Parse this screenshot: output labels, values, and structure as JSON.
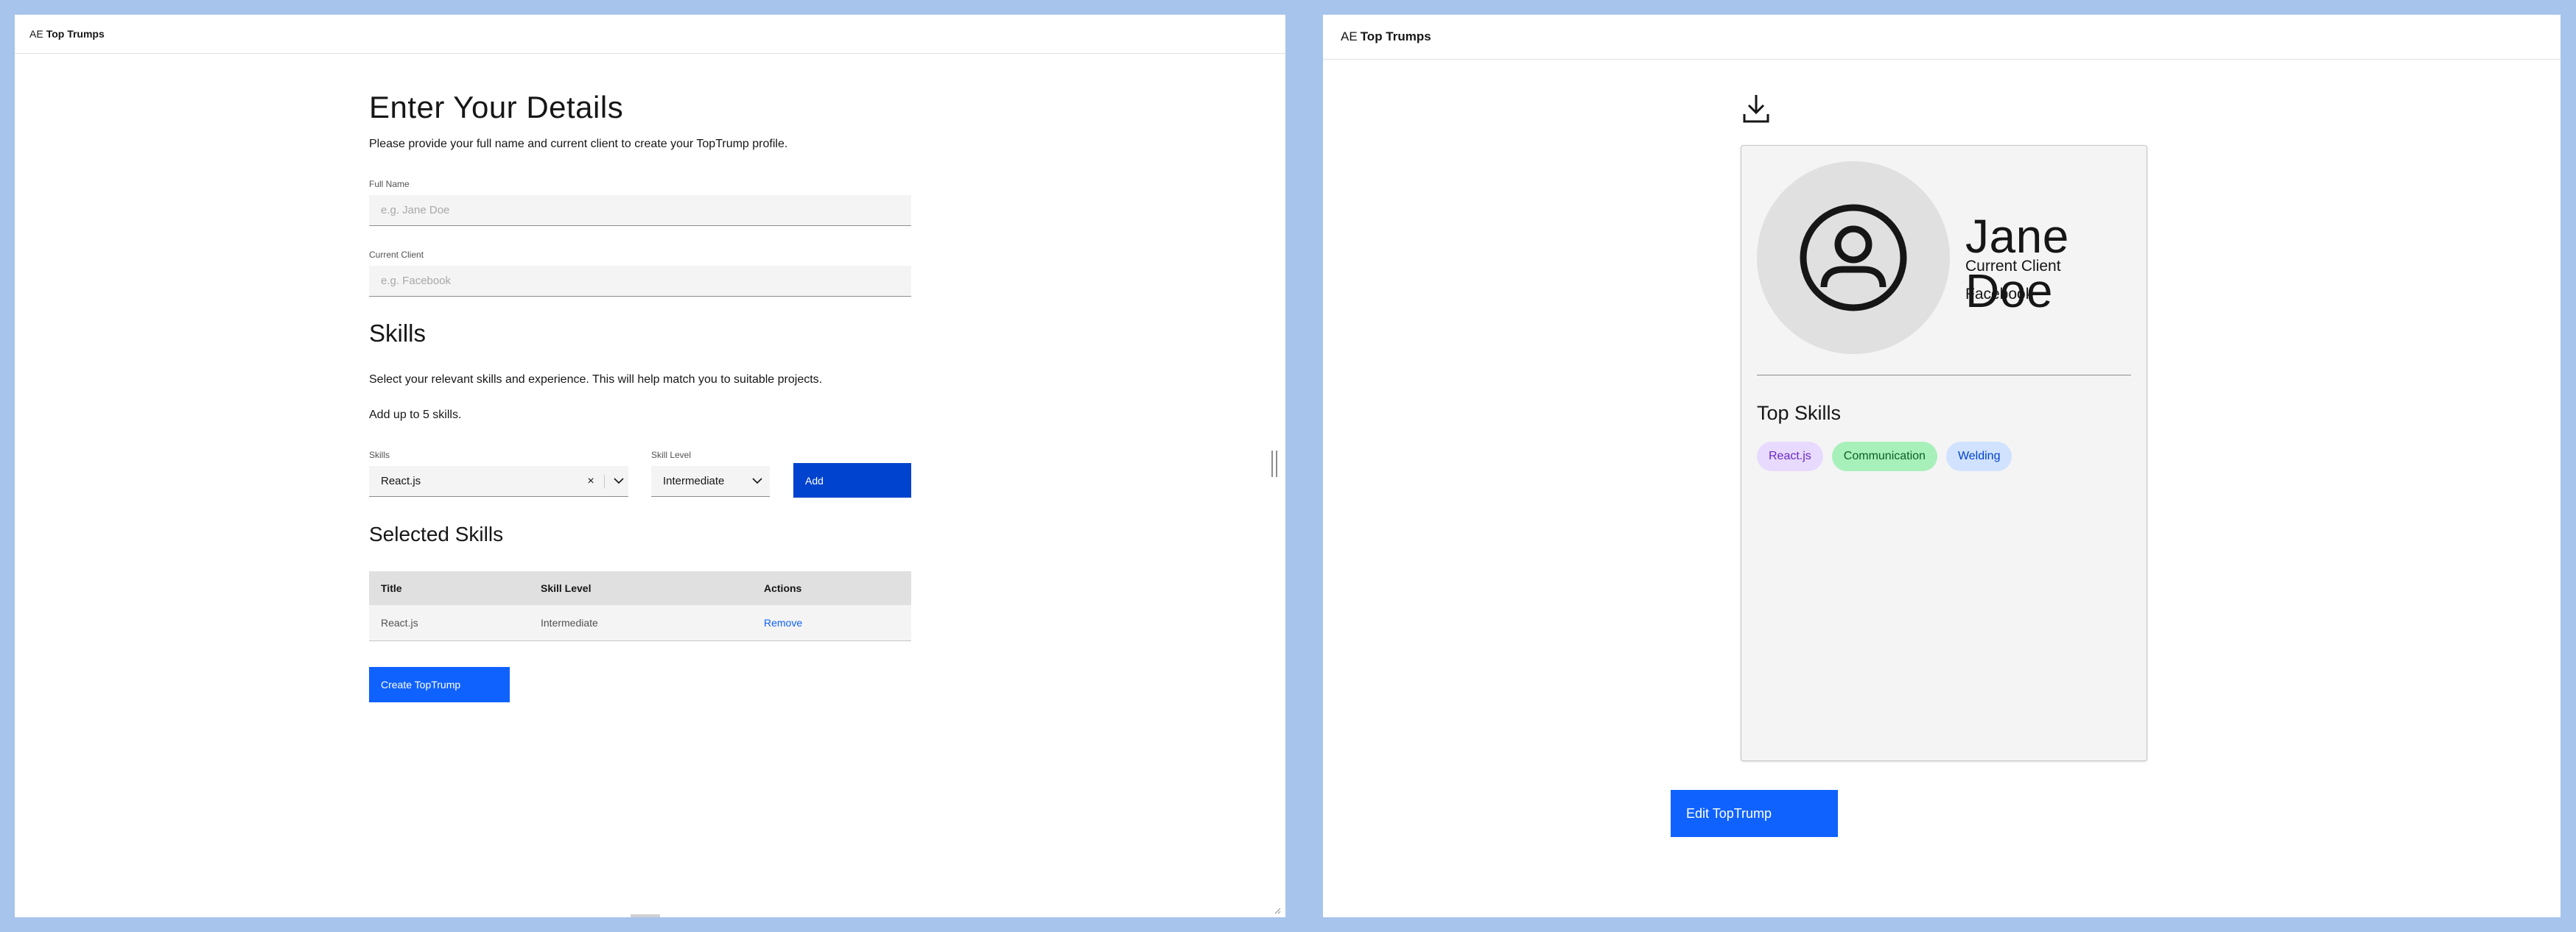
{
  "left": {
    "brand_prefix": "AE",
    "brand_name": "Top Trumps",
    "title": "Enter Your Details",
    "intro": "Please provide your full name and current client to create your TopTrump profile.",
    "full_name": {
      "label": "Full Name",
      "placeholder": "e.g. Jane Doe",
      "value": ""
    },
    "current_client": {
      "label": "Current Client",
      "placeholder": "e.g. Facebook",
      "value": ""
    },
    "skills_heading": "Skills",
    "skills_desc": "Select your relevant skills and experience. This will help match you to suitable projects.",
    "skills_limit": "Add up to 5 skills.",
    "skill_combo": {
      "label": "Skills",
      "value": "React.js",
      "clear": "×"
    },
    "skill_level": {
      "label": "Skill Level",
      "value": "Intermediate"
    },
    "add_label": "Add",
    "selected_heading": "Selected Skills",
    "table": {
      "headers": [
        "Title",
        "Skill Level",
        "Actions"
      ],
      "rows": [
        {
          "title": "React.js",
          "level": "Intermediate",
          "action": "Remove"
        }
      ]
    },
    "create_label": "Create TopTrump"
  },
  "right": {
    "brand_prefix": "AE",
    "brand_name": "Top Trumps",
    "name": "Jane Doe",
    "client_label": "Current Client",
    "client_value": "Facebook",
    "top_skills_title": "Top Skills",
    "skills": [
      {
        "name": "React.js",
        "color": "purple"
      },
      {
        "name": "Communication",
        "color": "green"
      },
      {
        "name": "Welding",
        "color": "blue"
      }
    ],
    "edit_label": "Edit TopTrump"
  },
  "colors": {
    "background": "#a6c4ec",
    "primary": "#0f62fe",
    "field": "#f4f4f4"
  }
}
